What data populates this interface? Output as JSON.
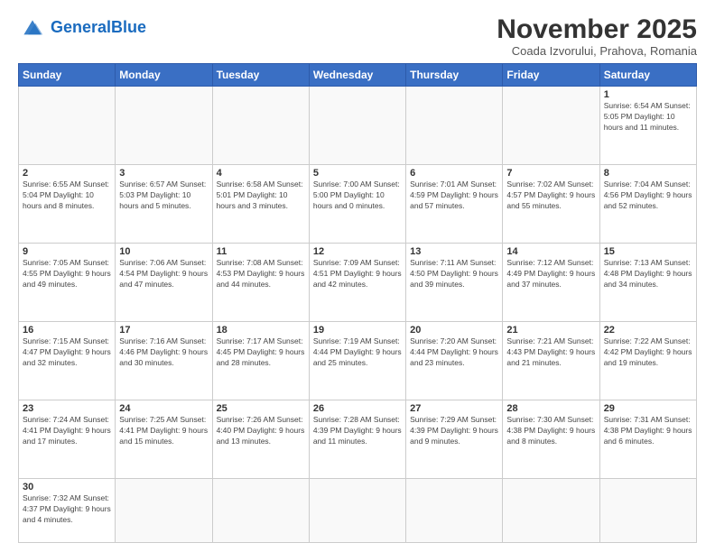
{
  "header": {
    "logo_general": "General",
    "logo_blue": "Blue",
    "month_title": "November 2025",
    "subtitle": "Coada Izvorului, Prahova, Romania"
  },
  "days_of_week": [
    "Sunday",
    "Monday",
    "Tuesday",
    "Wednesday",
    "Thursday",
    "Friday",
    "Saturday"
  ],
  "weeks": [
    [
      {
        "day": "",
        "info": ""
      },
      {
        "day": "",
        "info": ""
      },
      {
        "day": "",
        "info": ""
      },
      {
        "day": "",
        "info": ""
      },
      {
        "day": "",
        "info": ""
      },
      {
        "day": "",
        "info": ""
      },
      {
        "day": "1",
        "info": "Sunrise: 6:54 AM\nSunset: 5:05 PM\nDaylight: 10 hours\nand 11 minutes."
      }
    ],
    [
      {
        "day": "2",
        "info": "Sunrise: 6:55 AM\nSunset: 5:04 PM\nDaylight: 10 hours\nand 8 minutes."
      },
      {
        "day": "3",
        "info": "Sunrise: 6:57 AM\nSunset: 5:03 PM\nDaylight: 10 hours\nand 5 minutes."
      },
      {
        "day": "4",
        "info": "Sunrise: 6:58 AM\nSunset: 5:01 PM\nDaylight: 10 hours\nand 3 minutes."
      },
      {
        "day": "5",
        "info": "Sunrise: 7:00 AM\nSunset: 5:00 PM\nDaylight: 10 hours\nand 0 minutes."
      },
      {
        "day": "6",
        "info": "Sunrise: 7:01 AM\nSunset: 4:59 PM\nDaylight: 9 hours\nand 57 minutes."
      },
      {
        "day": "7",
        "info": "Sunrise: 7:02 AM\nSunset: 4:57 PM\nDaylight: 9 hours\nand 55 minutes."
      },
      {
        "day": "8",
        "info": "Sunrise: 7:04 AM\nSunset: 4:56 PM\nDaylight: 9 hours\nand 52 minutes."
      }
    ],
    [
      {
        "day": "9",
        "info": "Sunrise: 7:05 AM\nSunset: 4:55 PM\nDaylight: 9 hours\nand 49 minutes."
      },
      {
        "day": "10",
        "info": "Sunrise: 7:06 AM\nSunset: 4:54 PM\nDaylight: 9 hours\nand 47 minutes."
      },
      {
        "day": "11",
        "info": "Sunrise: 7:08 AM\nSunset: 4:53 PM\nDaylight: 9 hours\nand 44 minutes."
      },
      {
        "day": "12",
        "info": "Sunrise: 7:09 AM\nSunset: 4:51 PM\nDaylight: 9 hours\nand 42 minutes."
      },
      {
        "day": "13",
        "info": "Sunrise: 7:11 AM\nSunset: 4:50 PM\nDaylight: 9 hours\nand 39 minutes."
      },
      {
        "day": "14",
        "info": "Sunrise: 7:12 AM\nSunset: 4:49 PM\nDaylight: 9 hours\nand 37 minutes."
      },
      {
        "day": "15",
        "info": "Sunrise: 7:13 AM\nSunset: 4:48 PM\nDaylight: 9 hours\nand 34 minutes."
      }
    ],
    [
      {
        "day": "16",
        "info": "Sunrise: 7:15 AM\nSunset: 4:47 PM\nDaylight: 9 hours\nand 32 minutes."
      },
      {
        "day": "17",
        "info": "Sunrise: 7:16 AM\nSunset: 4:46 PM\nDaylight: 9 hours\nand 30 minutes."
      },
      {
        "day": "18",
        "info": "Sunrise: 7:17 AM\nSunset: 4:45 PM\nDaylight: 9 hours\nand 28 minutes."
      },
      {
        "day": "19",
        "info": "Sunrise: 7:19 AM\nSunset: 4:44 PM\nDaylight: 9 hours\nand 25 minutes."
      },
      {
        "day": "20",
        "info": "Sunrise: 7:20 AM\nSunset: 4:44 PM\nDaylight: 9 hours\nand 23 minutes."
      },
      {
        "day": "21",
        "info": "Sunrise: 7:21 AM\nSunset: 4:43 PM\nDaylight: 9 hours\nand 21 minutes."
      },
      {
        "day": "22",
        "info": "Sunrise: 7:22 AM\nSunset: 4:42 PM\nDaylight: 9 hours\nand 19 minutes."
      }
    ],
    [
      {
        "day": "23",
        "info": "Sunrise: 7:24 AM\nSunset: 4:41 PM\nDaylight: 9 hours\nand 17 minutes."
      },
      {
        "day": "24",
        "info": "Sunrise: 7:25 AM\nSunset: 4:41 PM\nDaylight: 9 hours\nand 15 minutes."
      },
      {
        "day": "25",
        "info": "Sunrise: 7:26 AM\nSunset: 4:40 PM\nDaylight: 9 hours\nand 13 minutes."
      },
      {
        "day": "26",
        "info": "Sunrise: 7:28 AM\nSunset: 4:39 PM\nDaylight: 9 hours\nand 11 minutes."
      },
      {
        "day": "27",
        "info": "Sunrise: 7:29 AM\nSunset: 4:39 PM\nDaylight: 9 hours\nand 9 minutes."
      },
      {
        "day": "28",
        "info": "Sunrise: 7:30 AM\nSunset: 4:38 PM\nDaylight: 9 hours\nand 8 minutes."
      },
      {
        "day": "29",
        "info": "Sunrise: 7:31 AM\nSunset: 4:38 PM\nDaylight: 9 hours\nand 6 minutes."
      }
    ],
    [
      {
        "day": "30",
        "info": "Sunrise: 7:32 AM\nSunset: 4:37 PM\nDaylight: 9 hours\nand 4 minutes."
      },
      {
        "day": "",
        "info": ""
      },
      {
        "day": "",
        "info": ""
      },
      {
        "day": "",
        "info": ""
      },
      {
        "day": "",
        "info": ""
      },
      {
        "day": "",
        "info": ""
      },
      {
        "day": "",
        "info": ""
      }
    ]
  ]
}
